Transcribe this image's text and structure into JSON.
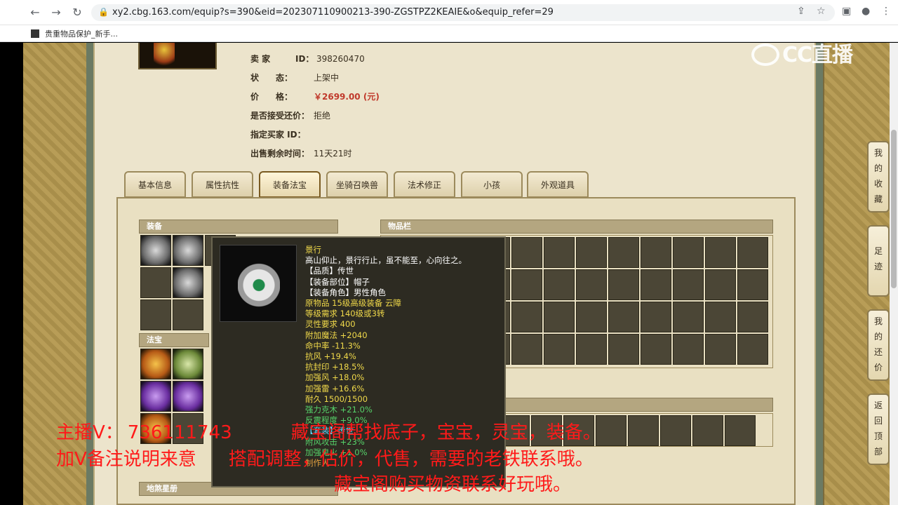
{
  "browser": {
    "url": "xy2.cbg.163.com/equip?s=390&eid=202307110900213-390-ZGSTPZ2KEAIE&o&equip_refer=29",
    "bookmark": "贵重物品保护_新手..."
  },
  "info": {
    "seller_label": "卖 家",
    "seller_id_label": "ID：",
    "seller_id": "398260470",
    "status_label": "状　　态：",
    "status": "上架中",
    "price_label": "价　　格：",
    "price": "￥2699.00 (元)",
    "counter_label": "是否接受还价：",
    "counter": "拒绝",
    "buyer_label": "指定买家 ID：",
    "time_label": "出售剩余时间：",
    "time": "11天21时"
  },
  "tabs": [
    "基本信息",
    "属性抗性",
    "装备法宝",
    "坐骑召唤兽",
    "法术修正",
    "小孩",
    "外观道具"
  ],
  "sections": {
    "equip": "装备",
    "inventory": "物品栏",
    "fabao": "法宝",
    "disha": "地煞星册"
  },
  "tooltip": {
    "name": "景行",
    "desc": "高山仰止，景行行止，虽不能至，心向往之。",
    "quality": "【品质】传世",
    "slot": "【装备部位】帽子",
    "role": "【装备角色】男性角色",
    "origin": "原物品 15级高级装备 云障",
    "level": "等级需求 140级或3转",
    "spirit": "灵性要求 400",
    "magic": "附加魔法 +2040",
    "hit": "命中率 -11.3%",
    "wind_res": "抗风 +19.4%",
    "seal_res": "抗封印 +18.5%",
    "wind_boost": "加强风 +18.0%",
    "thunder_boost": "加强雷 +16.6%",
    "durability": "耐久 1500/1500",
    "ke_mu": "强力克木 +21.0%",
    "zhen": "反震程度 +9.0%",
    "set": "【套装】传世",
    "wind_atk": "附风攻击 +23%",
    "ghost_fire": "加强鬼火 +1.0%",
    "maker": "制作人 ..."
  },
  "side_buttons": [
    [
      "我",
      "的",
      "收",
      "藏"
    ],
    [
      "足",
      "迹"
    ],
    [
      "我",
      "的",
      "还",
      "价"
    ],
    [
      "返",
      "回",
      "顶",
      "部"
    ]
  ],
  "logo": "CC直播",
  "overlay": {
    "line1a": "主播V：",
    "line1b": "736111743",
    "line1c": "藏宝阁帮找底子，宝宝，灵宝，装备。",
    "line2a": "加V备注说明来意",
    "line2b": "搭配调整，估价，代售，需要的老铁联系哦。",
    "line3": "藏宝阁购买物资联系好玩哦。"
  }
}
